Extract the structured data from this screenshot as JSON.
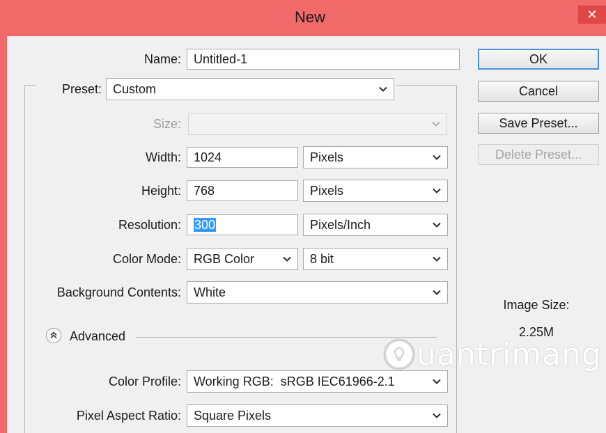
{
  "window": {
    "title": "New",
    "close_glyph": "✕"
  },
  "form": {
    "name_label": "Name:",
    "name_value": "Untitled-1",
    "preset_label": "Preset:",
    "preset_value": "Custom",
    "size_label": "Size:",
    "size_value": "",
    "width_label": "Width:",
    "width_value": "1024",
    "width_unit": "Pixels",
    "height_label": "Height:",
    "height_value": "768",
    "height_unit": "Pixels",
    "resolution_label": "Resolution:",
    "resolution_value": "300",
    "resolution_unit": "Pixels/Inch",
    "color_mode_label": "Color Mode:",
    "color_mode_value": "RGB Color",
    "bit_depth_value": "8 bit",
    "background_label": "Background Contents:",
    "background_value": "White",
    "advanced_label": "Advanced",
    "color_profile_label": "Color Profile:",
    "color_profile_value": "Working RGB:  sRGB IEC61966-2.1",
    "pixel_aspect_label": "Pixel Aspect Ratio:",
    "pixel_aspect_value": "Square Pixels"
  },
  "buttons": {
    "ok": "OK",
    "cancel": "Cancel",
    "save_preset": "Save Preset...",
    "delete_preset": "Delete Preset..."
  },
  "info": {
    "image_size_label": "Image Size:",
    "image_size_value": "2.25M"
  },
  "watermark": {
    "text": "uantrimang"
  },
  "colors": {
    "titlebar": "#f06a6a",
    "dialog_bg": "#f0f0f0",
    "selection": "#3399ff",
    "default_button_border": "#4a90d8"
  },
  "icons": [
    "close-icon",
    "chevron-down-icon",
    "collapse-up-icon",
    "lightbulb-icon"
  ]
}
